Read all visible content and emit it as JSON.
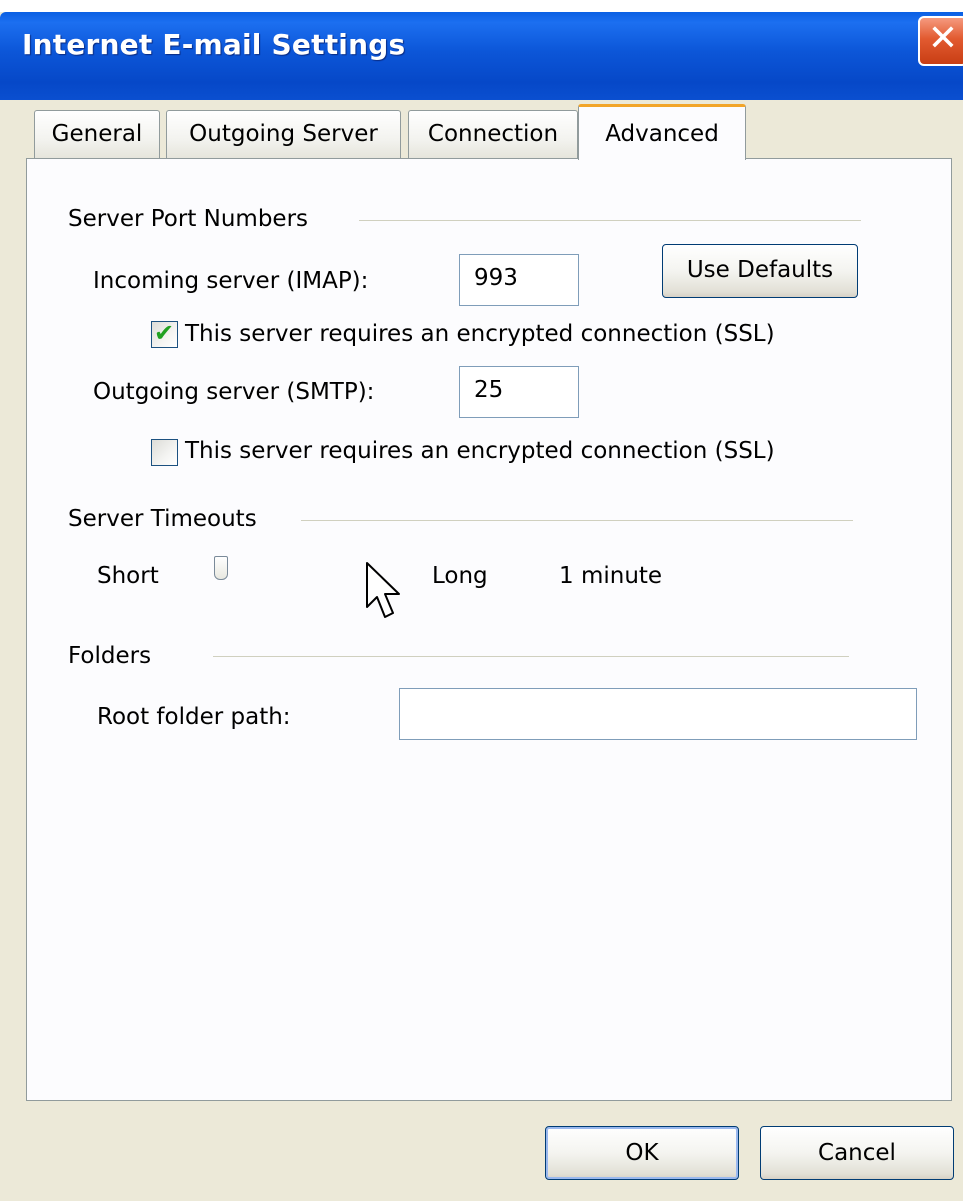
{
  "window": {
    "title": "Internet E-mail Settings",
    "close_glyph": "✕"
  },
  "tabs": [
    {
      "label": "General",
      "active": false
    },
    {
      "label": "Outgoing Server",
      "active": false
    },
    {
      "label": "Connection",
      "active": false
    },
    {
      "label": "Advanced",
      "active": true
    }
  ],
  "server_ports": {
    "group_label": "Server Port Numbers",
    "incoming_label": "Incoming server (IMAP):",
    "incoming_value": "993",
    "use_defaults_label": "Use Defaults",
    "incoming_ssl_label": "This server requires an encrypted connection (SSL)",
    "incoming_ssl_checked": true,
    "outgoing_label": "Outgoing server (SMTP):",
    "outgoing_value": "25",
    "outgoing_ssl_label": "This server requires an encrypted connection (SSL)",
    "outgoing_ssl_checked": false
  },
  "server_timeouts": {
    "group_label": "Server Timeouts",
    "short_label": "Short",
    "long_label": "Long",
    "value_label": "1 minute",
    "slider_level": 0.05
  },
  "folders": {
    "group_label": "Folders",
    "root_path_label": "Root folder path:",
    "root_path_value": ""
  },
  "footer": {
    "ok_label": "OK",
    "cancel_label": "Cancel"
  },
  "icons": {
    "close": "close-icon",
    "check": "checkmark-icon",
    "cursor": "mouse-pointer-icon"
  },
  "colors": {
    "titlebar": "#0a4fd0",
    "active_tab_accent": "#f2a529",
    "checkmark": "#21a121",
    "window_bg": "#ece9d8"
  }
}
